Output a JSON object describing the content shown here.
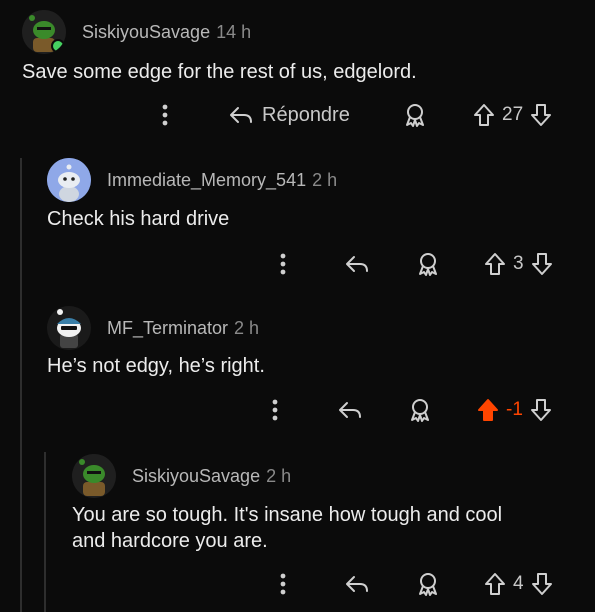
{
  "colors": {
    "background": "#0b0b0b",
    "text": "#ececec",
    "meta": "#8a8a8a",
    "upvote_active": "#ff4500"
  },
  "comments": [
    {
      "username": "SiskiyouSavage",
      "time": "14 h",
      "body": [
        "Save some edge for the rest of us, edgelord."
      ],
      "reply_label": "Répondre",
      "score": "27",
      "vote_state": "none",
      "icons": [
        "more-icon",
        "reply-icon",
        "award-icon",
        "upvote-icon",
        "downvote-icon"
      ]
    },
    {
      "username": "Immediate_Memory_541",
      "time": "2 h",
      "body": [
        "Check his hard drive"
      ],
      "score": "3",
      "vote_state": "none"
    },
    {
      "username": "MF_Terminator",
      "time": "2 h",
      "body": [
        "He’s not edgy, he’s right."
      ],
      "score": "-1",
      "vote_state": "upvoted"
    },
    {
      "username": "SiskiyouSavage",
      "time": "2 h",
      "body": [
        "You are so tough. It's insane how tough and cool",
        "and hardcore you are."
      ],
      "score": "4",
      "vote_state": "none"
    }
  ]
}
